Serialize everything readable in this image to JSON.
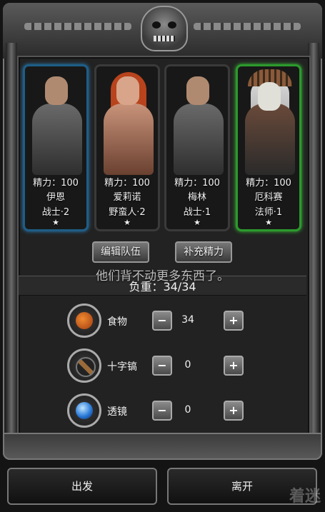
{
  "party": [
    {
      "energy": "精力：100",
      "name": "伊恩",
      "class": "战士·2",
      "star": "★"
    },
    {
      "energy": "精力：100",
      "name": "爱莉诺",
      "class": "野蛮人·2",
      "star": "★"
    },
    {
      "energy": "精力：100",
      "name": "梅林",
      "class": "战士·1",
      "star": "★"
    },
    {
      "energy": "精力：100",
      "name": "厄科赛",
      "class": "法师·1",
      "star": "★"
    }
  ],
  "buttons": {
    "edit_team": "编辑队伍",
    "restore_energy": "补充精力"
  },
  "notice": "他们背不动更多东西了。",
  "load": "负重：34/34",
  "supplies": [
    {
      "label": "食物",
      "qty": "34",
      "minus": "−",
      "plus": "+",
      "icon": "food-icon"
    },
    {
      "label": "十字镐",
      "qty": "0",
      "minus": "−",
      "plus": "+",
      "icon": "pickaxe-icon"
    },
    {
      "label": "透镜",
      "qty": "0",
      "minus": "−",
      "plus": "+",
      "icon": "lens-icon"
    }
  ],
  "actions": {
    "depart": "出发",
    "leave": "离开"
  },
  "watermark": "着迷"
}
